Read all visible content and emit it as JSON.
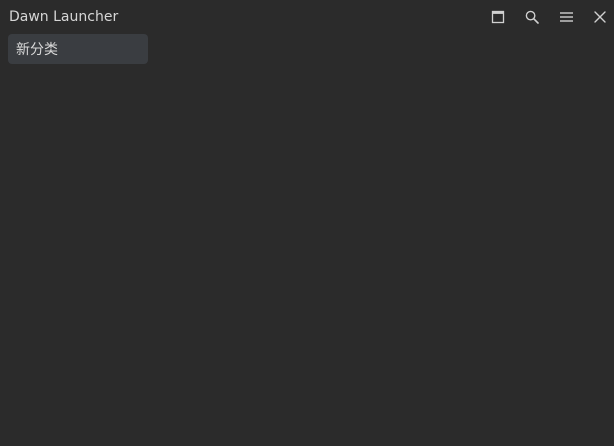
{
  "app": {
    "title": "Dawn Launcher"
  },
  "toolbar": {
    "icons": [
      "window-maximize-icon",
      "search-icon",
      "menu-icon",
      "close-icon"
    ]
  },
  "categories": [
    {
      "label": "新分类"
    }
  ],
  "colors": {
    "background": "#2b2b2b",
    "category_background": "#3a3d41",
    "text": "#d8d8d8"
  }
}
